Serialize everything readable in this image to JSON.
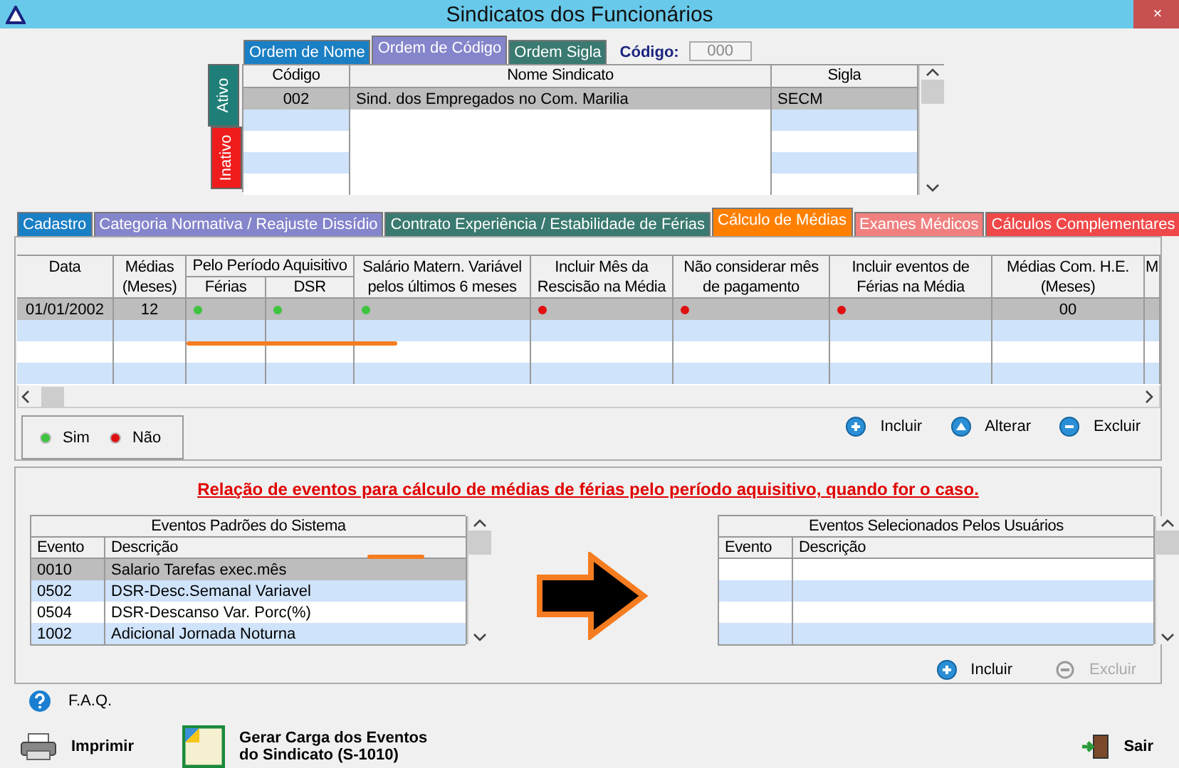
{
  "window": {
    "title": "Sindicatos dos Funcionários",
    "close": "×"
  },
  "order_tabs": [
    {
      "label": "Ordem de Nome",
      "selected": false,
      "color": "#1a7fc4"
    },
    {
      "label": "Ordem de Código",
      "selected": true,
      "color": "#8585cc"
    },
    {
      "label": "Ordem Sigla",
      "selected": false,
      "color": "#3a7a70"
    }
  ],
  "code_filter": {
    "label": "Código:",
    "value": "000"
  },
  "status_tabs": [
    {
      "label": "Ativo",
      "selected": true,
      "color": "#1f7f78"
    },
    {
      "label": "Inativo",
      "selected": false,
      "color": "#ee1c1c"
    }
  ],
  "unions_table": {
    "columns": [
      "Código",
      "Nome Sindicato",
      "Sigla"
    ],
    "rows": [
      {
        "cells": [
          "002",
          "Sind. dos Empregados no Com. Marilia",
          "SECM"
        ],
        "selected": true
      }
    ]
  },
  "main_tabs": [
    {
      "label": "Cadastro",
      "selected": false,
      "color": "#1a7fc4"
    },
    {
      "label": "Categoria Normativa / Reajuste Dissídio",
      "selected": false,
      "color": "#8585cc"
    },
    {
      "label": "Contrato Experiência / Estabilidade de Férias",
      "selected": false,
      "color": "#3a7a70"
    },
    {
      "label": "Cálculo de Médias",
      "selected": true,
      "color": "#ff8000"
    },
    {
      "label": "Exames Médicos",
      "selected": false,
      "color": "#f08080"
    },
    {
      "label": "Cálculos Complementares",
      "selected": false,
      "color": "#f04848"
    }
  ],
  "averages_table": {
    "columns": [
      {
        "kind": "single",
        "lines": [
          "Data"
        ]
      },
      {
        "kind": "single",
        "lines": [
          "Médias",
          "(Meses)"
        ]
      },
      {
        "kind": "group",
        "group": "Pelo Período Aquisitivo",
        "subs": [
          "Férias",
          "DSR"
        ]
      },
      {
        "kind": "single",
        "lines": [
          "Salário Matern. Variável",
          "pelos últimos 6 meses"
        ]
      },
      {
        "kind": "single",
        "lines": [
          "Incluir Mês da",
          "Rescisão na Média"
        ]
      },
      {
        "kind": "single",
        "lines": [
          "Não considerar mês",
          "de pagamento"
        ]
      },
      {
        "kind": "single",
        "lines": [
          "Incluir eventos de",
          "Férias na Média"
        ]
      },
      {
        "kind": "single",
        "lines": [
          "Médias Com. H.E.",
          "(Meses)"
        ]
      },
      {
        "kind": "single",
        "lines": [
          "M"
        ]
      }
    ],
    "rows": [
      {
        "date": "01/01/2002",
        "months": "12",
        "flags": [
          true,
          true,
          true,
          false,
          false,
          false
        ],
        "he_months": "00",
        "selected": true
      }
    ]
  },
  "legend": [
    {
      "label": "Sim",
      "value": true
    },
    {
      "label": "Não",
      "value": false
    }
  ],
  "average_actions": [
    {
      "label": "Incluir",
      "kind": "add"
    },
    {
      "label": "Alterar",
      "kind": "edit"
    },
    {
      "label": "Excluir",
      "kind": "remove"
    }
  ],
  "events": {
    "title": "Relação de eventos para cálculo de médias de férias pelo período aquisitivo, quando for o caso.",
    "system_events": {
      "title": "Eventos Padrões do Sistema",
      "columns": [
        "Evento",
        "Descrição"
      ],
      "rows": [
        {
          "code": "0010",
          "description": "Salario Tarefas exec.mês",
          "selected": true
        },
        {
          "code": "0502",
          "description": "DSR-Desc.Semanal Variavel",
          "selected": false
        },
        {
          "code": "0504",
          "description": "DSR-Descanso Var. Porc(%)",
          "selected": false
        },
        {
          "code": "1002",
          "description": "Adicional Jornada Noturna",
          "selected": false
        }
      ]
    },
    "user_events": {
      "title": "Eventos Selecionados Pelos Usuários",
      "columns": [
        "Evento",
        "Descrição"
      ]
    },
    "actions": [
      {
        "label": "Incluir",
        "kind": "add",
        "disabled": false
      },
      {
        "label": "Excluir",
        "kind": "remove",
        "disabled": true
      }
    ]
  },
  "faq": {
    "label": "F.A.Q."
  },
  "footer": [
    {
      "kind": "print",
      "lines": [
        "Imprimir"
      ]
    },
    {
      "kind": "generate",
      "lines": [
        "Gerar Carga dos Eventos",
        "do Sindicato (S-1010)"
      ]
    },
    {
      "kind": "exit",
      "lines": [
        "Sair"
      ]
    }
  ]
}
